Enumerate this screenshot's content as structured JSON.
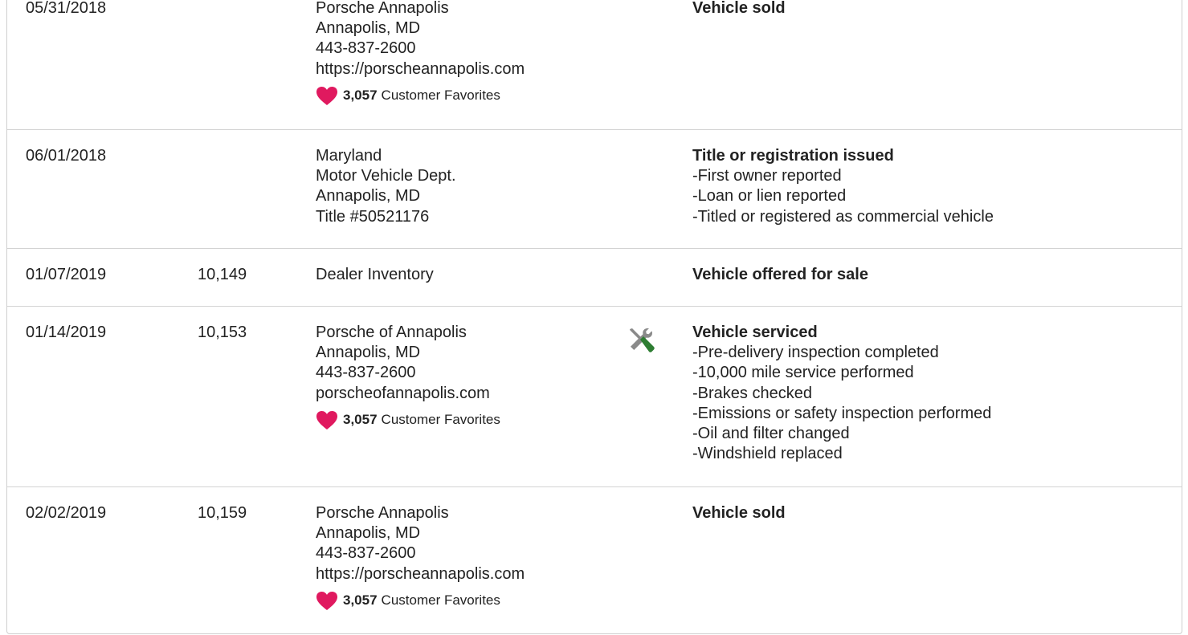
{
  "records": [
    {
      "date": "05/31/2018",
      "mileage": "",
      "source_lines": [
        "Porsche Annapolis",
        "Annapolis, MD",
        "443-837-2600",
        "https://porscheannapolis.com"
      ],
      "favorites": {
        "count": "3,057",
        "label": "Customer Favorites"
      },
      "icon": "",
      "event_title": "Vehicle sold",
      "event_details": []
    },
    {
      "date": "06/01/2018",
      "mileage": "",
      "source_lines": [
        "Maryland",
        "Motor Vehicle Dept.",
        "Annapolis, MD",
        "Title #50521176"
      ],
      "favorites": null,
      "icon": "",
      "event_title": "Title or registration issued",
      "event_details": [
        "-First owner reported",
        "-Loan or lien reported",
        "-Titled or registered as commercial vehicle"
      ]
    },
    {
      "date": "01/07/2019",
      "mileage": "10,149",
      "source_lines": [
        "Dealer Inventory"
      ],
      "favorites": null,
      "icon": "",
      "event_title": "Vehicle offered for sale",
      "event_details": []
    },
    {
      "date": "01/14/2019",
      "mileage": "10,153",
      "source_lines": [
        "Porsche of Annapolis",
        "Annapolis, MD",
        "443-837-2600",
        "porscheofannapolis.com"
      ],
      "favorites": {
        "count": "3,057",
        "label": "Customer Favorites"
      },
      "icon": "wrench-screwdriver-icon",
      "event_title": "Vehicle serviced",
      "event_details": [
        "-Pre-delivery inspection completed",
        "-10,000 mile service performed",
        "-Brakes checked",
        "-Emissions or safety inspection performed",
        "-Oil and filter changed",
        "-Windshield replaced"
      ]
    },
    {
      "date": "02/02/2019",
      "mileage": "10,159",
      "source_lines": [
        "Porsche Annapolis",
        "Annapolis, MD",
        "443-837-2600",
        "https://porscheannapolis.com"
      ],
      "favorites": {
        "count": "3,057",
        "label": "Customer Favorites"
      },
      "icon": "",
      "event_title": "Vehicle sold",
      "event_details": []
    }
  ],
  "colors": {
    "heart": "#e0195f",
    "service_icon_gray": "#8a8a8a",
    "service_icon_green": "#2e7d32",
    "border": "#d3d3d3",
    "text": "#222222"
  }
}
